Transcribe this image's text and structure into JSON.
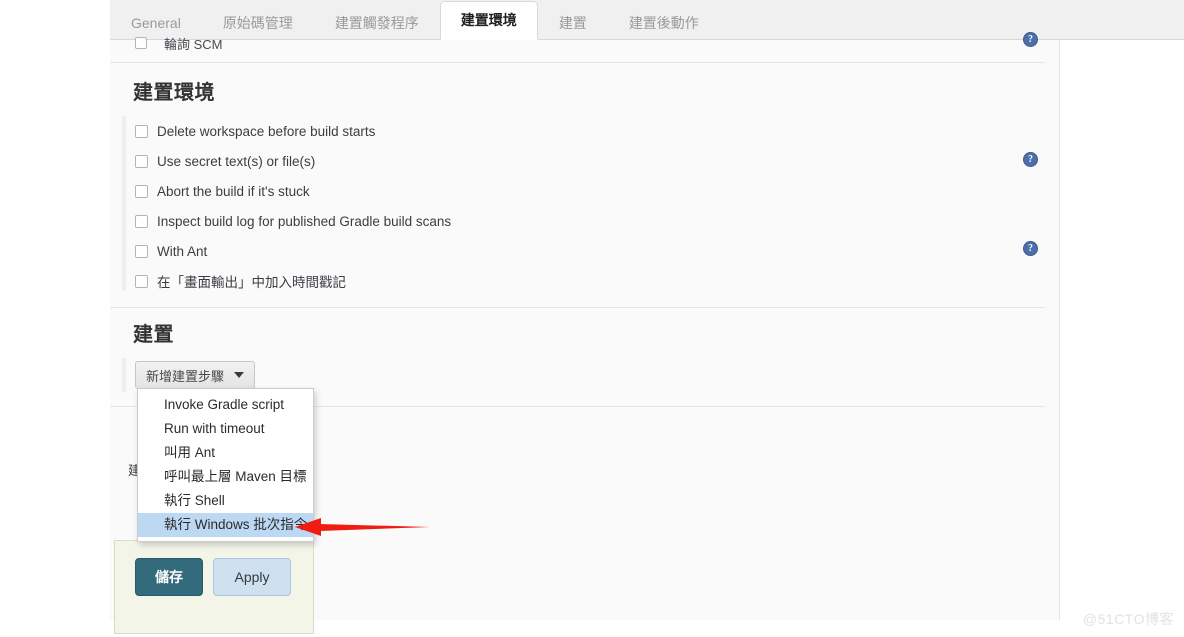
{
  "tabs": [
    {
      "label": "General",
      "active": false
    },
    {
      "label": "原始碼管理",
      "active": false
    },
    {
      "label": "建置觸發程序",
      "active": false
    },
    {
      "label": "建置環境",
      "active": true
    },
    {
      "label": "建置",
      "active": false
    },
    {
      "label": "建置後動作",
      "active": false
    }
  ],
  "cutoff_row": {
    "label": "輪詢 SCM"
  },
  "sections": {
    "build_env": {
      "title": "建置環境",
      "checkboxes": [
        {
          "label": "Delete workspace before build starts",
          "checked": false,
          "help": false
        },
        {
          "label": "Use secret text(s) or file(s)",
          "checked": false,
          "help": true
        },
        {
          "label": "Abort the build if it's stuck",
          "checked": false,
          "help": false
        },
        {
          "label": "Inspect build log for published Gradle build scans",
          "checked": false,
          "help": false
        },
        {
          "label": "With Ant",
          "checked": false,
          "help": true
        },
        {
          "label": "在「畫面輸出」中加入時間戳記",
          "checked": false,
          "help": false
        }
      ]
    },
    "build": {
      "title": "建置",
      "add_step_button": "新增建置步驟",
      "dropdown_items": [
        {
          "label": "Invoke Gradle script",
          "selected": false
        },
        {
          "label": "Run with timeout",
          "selected": false
        },
        {
          "label": "叫用 Ant",
          "selected": false
        },
        {
          "label": "呼叫最上層 Maven 目標",
          "selected": false
        },
        {
          "label": "執行 Shell",
          "selected": false
        },
        {
          "label": "執行 Windows 批次指令",
          "selected": true
        }
      ]
    }
  },
  "footer": {
    "save_label": "儲存",
    "apply_label": "Apply"
  },
  "icons": {
    "help": "?",
    "caret_down": "chevron-down-icon"
  },
  "annotation": {
    "arrow_color": "#ee1c11",
    "points_to": "執行 Windows 批次指令"
  },
  "watermark": "@51CTO博客",
  "colors": {
    "active_tab_bg": "#ffffff",
    "tabbar_bg": "#f0f0f0",
    "panel_bg": "#fafafa",
    "dropdown_selected_bg": "#bcd8f2",
    "save_button_bg": "#336b7c",
    "apply_button_bg": "#cfe0ef",
    "savebar_bg": "#f3f5e9",
    "help_icon_bg": "#4d6fa8"
  }
}
